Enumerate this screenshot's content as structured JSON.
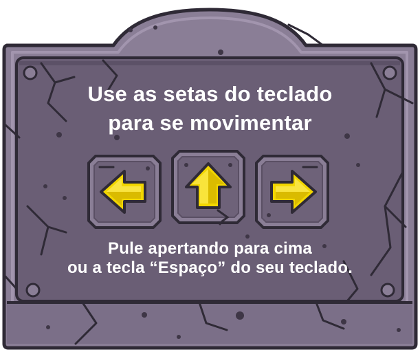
{
  "tutorial": {
    "heading_line1": "Use as setas do teclado",
    "heading_line2": "para se movimentar",
    "instruction_line1": "Pule apertando para cima",
    "instruction_line2": "ou a tecla “Espaço” do seu teclado."
  },
  "keys": [
    {
      "icon": "arrow-left-icon"
    },
    {
      "icon": "arrow-up-icon"
    },
    {
      "icon": "arrow-right-icon"
    }
  ],
  "colors": {
    "stone_outline": "#2f2a36",
    "stone_face": "#6a5e75",
    "stone_frame": "#8a7e96",
    "stone_rim": "#9f93ab",
    "arrow_fill": "#f2d600",
    "arrow_shade": "#c9a800",
    "text": "#ffffff"
  }
}
